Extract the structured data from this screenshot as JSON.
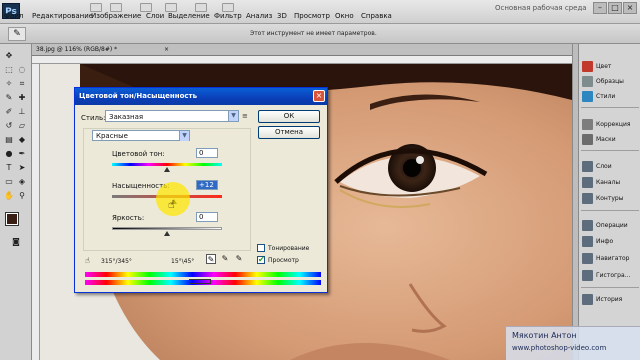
{
  "app": {
    "logo_text": "Ps",
    "workspace": "Основная рабочая среда"
  },
  "menu": [
    "Файл",
    "Редактирование",
    "Изображение",
    "Слои",
    "Выделение",
    "Фильтр",
    "Анализ",
    "3D",
    "Просмотр",
    "Окно",
    "Справка"
  ],
  "window_buttons": [
    "–",
    "□",
    "×"
  ],
  "options_bar": {
    "tool_icon": "eyedropper-icon",
    "message": "Этот инструмент не имеет параметров."
  },
  "document": {
    "tab_label": "38.jpg @ 116% (RGB/8#) *",
    "close": "×"
  },
  "right_panel": {
    "items": [
      {
        "label": "Цвет",
        "icon": "color-icon",
        "color": "#c0392b"
      },
      {
        "label": "Образцы",
        "icon": "swatches-icon",
        "color": "#7f8c8d"
      },
      {
        "label": "Стили",
        "icon": "styles-icon",
        "color": "#2e86c1"
      },
      {
        "label": "Коррекция",
        "icon": "adjustments-icon",
        "color": "#7d7d7d"
      },
      {
        "label": "Маски",
        "icon": "masks-icon",
        "color": "#6c6c6c"
      },
      {
        "label": "Слои",
        "icon": "layers-icon",
        "color": "#5d6d7e"
      },
      {
        "label": "Каналы",
        "icon": "channels-icon",
        "color": "#5d6d7e"
      },
      {
        "label": "Контуры",
        "icon": "paths-icon",
        "color": "#5d6d7e"
      },
      {
        "label": "Операции",
        "icon": "actions-icon",
        "color": "#5d6d7e"
      },
      {
        "label": "Инфо",
        "icon": "info-icon",
        "color": "#5d6d7e"
      },
      {
        "label": "Навигатор",
        "icon": "navigator-icon",
        "color": "#5d6d7e"
      },
      {
        "label": "Гистогра...",
        "icon": "histogram-icon",
        "color": "#5d6d7e"
      },
      {
        "label": "История",
        "icon": "history-icon",
        "color": "#5d6d7e"
      }
    ]
  },
  "dialog": {
    "title": "Цветовой тон/Насыщенность",
    "close": "×",
    "style_label": "Стиль:",
    "style_value": "Заказная",
    "channel_value": "Красные",
    "ok": "ОК",
    "cancel": "Отмена",
    "hue": {
      "label": "Цветовой тон:",
      "value": "0",
      "level": 0.5
    },
    "saturation": {
      "label": "Насыщенность:",
      "value": "+12",
      "level": 0.56
    },
    "lightness": {
      "label": "Яркость:",
      "value": "0",
      "level": 0.5
    },
    "range_left": "315°/345°",
    "range_right": "15°\\45°",
    "colorize_label": "Тонирование",
    "colorize_checked": false,
    "preview_label": "Просмотр",
    "preview_checked": true
  },
  "watermark": {
    "name": "Мякотин Антон",
    "url": "www.photoshop-video.com"
  }
}
